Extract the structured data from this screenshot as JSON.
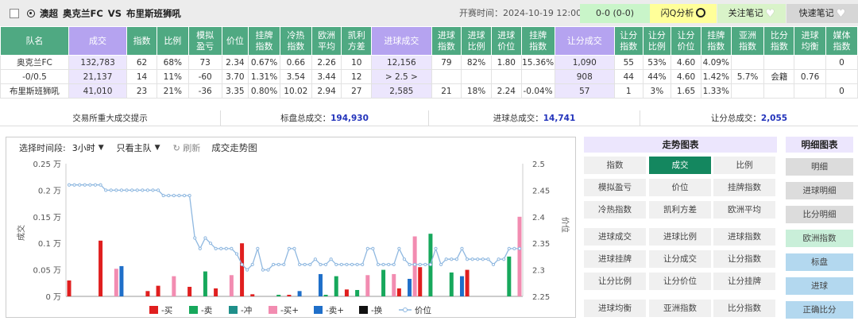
{
  "header": {
    "league": "澳超",
    "home": "奥克兰FC",
    "vs": "VS",
    "away": "布里斯班狮吼",
    "start_time": "开赛时间：2024-10-19 12:00",
    "score": "0-0 (0-0)",
    "q_analysis": "闪Q分析",
    "follow_notes": "关注笔记",
    "quick_notes": "快速笔记"
  },
  "table": {
    "headers": [
      "队名",
      "成交",
      "指数",
      "比例",
      "模拟\n盈亏",
      "价位",
      "挂牌\n指数",
      "冷热\n指数",
      "欧洲\n平均",
      "凯利\n方差",
      "进球成交",
      "进球\n指数",
      "进球\n比例",
      "进球\n价位",
      "挂牌\n指数",
      "让分成交",
      "让分\n指数",
      "让分\n比例",
      "让分\n价位",
      "挂牌\n指数",
      "亚洲\n指数",
      "比分\n指数",
      "进球\n均衡",
      "媒体\n指数"
    ],
    "rows": [
      [
        "奥克兰FC",
        "132,783",
        "62",
        "68%",
        "73",
        "2.34",
        "0.67%",
        "0.66",
        "2.26",
        "10",
        "12,156",
        "79",
        "82%",
        "1.80",
        "15.36%",
        "1,090",
        "55",
        "53%",
        "4.60",
        "4.09%",
        "",
        "",
        "",
        "0"
      ],
      [
        "-0/0.5",
        "21,137",
        "14",
        "11%",
        "-60",
        "3.70",
        "1.31%",
        "3.54",
        "3.44",
        "12",
        "> 2.5 >",
        "",
        "",
        "",
        "",
        "908",
        "44",
        "44%",
        "4.60",
        "1.42%",
        "5.7%",
        "会籍",
        "0.76",
        ""
      ],
      [
        "布里斯班狮吼",
        "41,010",
        "23",
        "21%",
        "-36",
        "3.35",
        "0.80%",
        "10.02",
        "2.94",
        "27",
        "2,585",
        "21",
        "18%",
        "2.24",
        "-0.04%",
        "57",
        "1",
        "3%",
        "1.65",
        "1.33%",
        "",
        "",
        "",
        "0"
      ]
    ]
  },
  "summary": {
    "hint": "交易所重大成交提示",
    "label1": "标盘总成交：",
    "value1": "194,930",
    "label2": "进球总成交：",
    "value2": "14,741",
    "label3": "让分总成交：",
    "value3": "2,055"
  },
  "toolbar": {
    "period_label": "选择时间段:",
    "period_value": "3小时",
    "team_filter": "只看主队",
    "refresh": "刷新",
    "chart_title": "成交走势图"
  },
  "right_panel": {
    "trend_header": "走势图表",
    "detail_header": "明细图表",
    "trend_buttons": [
      "指数",
      "成交",
      "比例",
      "模拟盈亏",
      "价位",
      "挂牌指数",
      "冷热指数",
      "凯利方差",
      "欧洲平均",
      "进球成交",
      "进球比例",
      "进球指数",
      "进球挂牌",
      "让分成交",
      "让分指数",
      "让分比例",
      "让分价位",
      "让分挂牌",
      "进球均衡",
      "亚洲指数",
      "比分指数"
    ],
    "active_button": "成交",
    "detail_buttons": [
      "明细",
      "进球明细",
      "比分明细",
      "欧洲指数",
      "标盘",
      "进球",
      "正确比分"
    ]
  },
  "chart_data": {
    "type": "bar",
    "ylabel": "成交",
    "y2label": "价位",
    "ylim": [
      0,
      0.25
    ],
    "yticks": [
      "0 万",
      "0.05 万",
      "0.1 万",
      "0.15 万",
      "0.2 万",
      "0.25 万"
    ],
    "y2lim": [
      2.25,
      2.5
    ],
    "y2ticks": [
      "2.25",
      "2.3",
      "2.35",
      "2.4",
      "2.45",
      "2.5"
    ],
    "legend_position": "bottom",
    "legend": [
      {
        "name": "-买",
        "color": "#e01f1f"
      },
      {
        "name": "-卖",
        "color": "#17a85c"
      },
      {
        "name": "-冲",
        "color": "#1f8f8a"
      },
      {
        "name": "-买+",
        "color": "#f28cb1"
      },
      {
        "name": "-卖+",
        "color": "#1f6fc9"
      },
      {
        "name": "-换",
        "color": "#111111"
      },
      {
        "name": "价位",
        "color": "#8fb8e0"
      }
    ],
    "bars": [
      {
        "i": 0,
        "s": "-买",
        "v": 0.03
      },
      {
        "i": 6,
        "s": "-买",
        "v": 0.105
      },
      {
        "i": 9,
        "s": "-买+",
        "v": 0.052
      },
      {
        "i": 10,
        "s": "-卖+",
        "v": 0.057
      },
      {
        "i": 15,
        "s": "-买",
        "v": 0.01
      },
      {
        "i": 17,
        "s": "-买",
        "v": 0.02
      },
      {
        "i": 20,
        "s": "-买+",
        "v": 0.038
      },
      {
        "i": 23,
        "s": "-买",
        "v": 0.018
      },
      {
        "i": 26,
        "s": "-卖",
        "v": 0.047
      },
      {
        "i": 28,
        "s": "-买",
        "v": 0.015
      },
      {
        "i": 31,
        "s": "-买+",
        "v": 0.04
      },
      {
        "i": 33,
        "s": "-买",
        "v": 0.1
      },
      {
        "i": 35,
        "s": "-买",
        "v": 0.004
      },
      {
        "i": 40,
        "s": "-卖",
        "v": 0.003
      },
      {
        "i": 42,
        "s": "-买",
        "v": 0.003
      },
      {
        "i": 44,
        "s": "-卖+",
        "v": 0.01
      },
      {
        "i": 48,
        "s": "-卖+",
        "v": 0.042
      },
      {
        "i": 49,
        "s": "-卖",
        "v": 0.003
      },
      {
        "i": 51,
        "s": "-卖",
        "v": 0.038
      },
      {
        "i": 53,
        "s": "-买",
        "v": 0.013
      },
      {
        "i": 55,
        "s": "-卖",
        "v": 0.012
      },
      {
        "i": 57,
        "s": "-买+",
        "v": 0.04
      },
      {
        "i": 60,
        "s": "-卖",
        "v": 0.05
      },
      {
        "i": 62,
        "s": "-买+",
        "v": 0.042
      },
      {
        "i": 63,
        "s": "-买",
        "v": 0.015
      },
      {
        "i": 65,
        "s": "-卖+",
        "v": 0.033
      },
      {
        "i": 66,
        "s": "-买+",
        "v": 0.113
      },
      {
        "i": 67,
        "s": "-买",
        "v": 0.055
      },
      {
        "i": 69,
        "s": "-卖",
        "v": 0.118
      },
      {
        "i": 73,
        "s": "-卖",
        "v": 0.045
      },
      {
        "i": 75,
        "s": "-卖+",
        "v": 0.038
      },
      {
        "i": 76,
        "s": "-买",
        "v": 0.05
      },
      {
        "i": 84,
        "s": "-卖",
        "v": 0.075
      },
      {
        "i": 86,
        "s": "-买+",
        "v": 0.15
      }
    ],
    "price": [
      2.46,
      2.46,
      2.46,
      2.46,
      2.46,
      2.46,
      2.46,
      2.45,
      2.45,
      2.45,
      2.45,
      2.45,
      2.45,
      2.45,
      2.45,
      2.45,
      2.45,
      2.45,
      2.44,
      2.44,
      2.44,
      2.44,
      2.44,
      2.44,
      2.36,
      2.34,
      2.36,
      2.35,
      2.34,
      2.34,
      2.34,
      2.34,
      2.33,
      2.31,
      2.3,
      2.31,
      2.34,
      2.3,
      2.3,
      2.31,
      2.31,
      2.31,
      2.34,
      2.34,
      2.31,
      2.31,
      2.31,
      2.32,
      2.31,
      2.31,
      2.32,
      2.31,
      2.31,
      2.31,
      2.31,
      2.31,
      2.31,
      2.34,
      2.34,
      2.31,
      2.31,
      2.31,
      2.31,
      2.34,
      2.32,
      2.31,
      2.31,
      2.31,
      2.31,
      2.31,
      2.34,
      2.31,
      2.32,
      2.32,
      2.32,
      2.34,
      2.32,
      2.32,
      2.32,
      2.32,
      2.32,
      2.31,
      2.32,
      2.32,
      2.34,
      2.34,
      2.34
    ],
    "n": 87
  }
}
